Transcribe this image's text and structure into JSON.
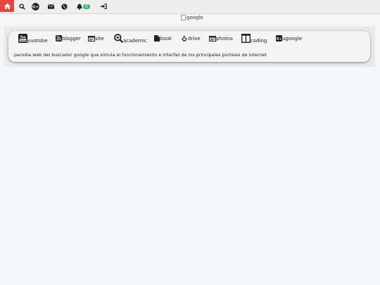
{
  "nav": {
    "notifications_count": "0"
  },
  "logo": {
    "alt": "google"
  },
  "links": [
    {
      "label": "yuotobe",
      "icon": "youtube-icon"
    },
    {
      "label": "blogger",
      "icon": "rss-icon"
    },
    {
      "label": "site",
      "icon": "browser-window-icon"
    },
    {
      "label": "academic",
      "icon": "magnify-plus-icon"
    },
    {
      "label": "book",
      "icon": "book-icon"
    },
    {
      "label": "drive",
      "icon": "recycle-icon"
    },
    {
      "label": "photos",
      "icon": "image-window-icon"
    },
    {
      "label": "coding",
      "icon": "columns-icon"
    },
    {
      "label": "ugoogle",
      "icon": "google-plus-square-icon"
    }
  ],
  "description": "parodia web del buscador google que simula el funcionamiento e interfaz de los principales portales de internet",
  "colors": {
    "home": "#e8453c",
    "badge": "#3cb371",
    "topbar": "#eeeeee",
    "page": "#f5f6f8"
  }
}
